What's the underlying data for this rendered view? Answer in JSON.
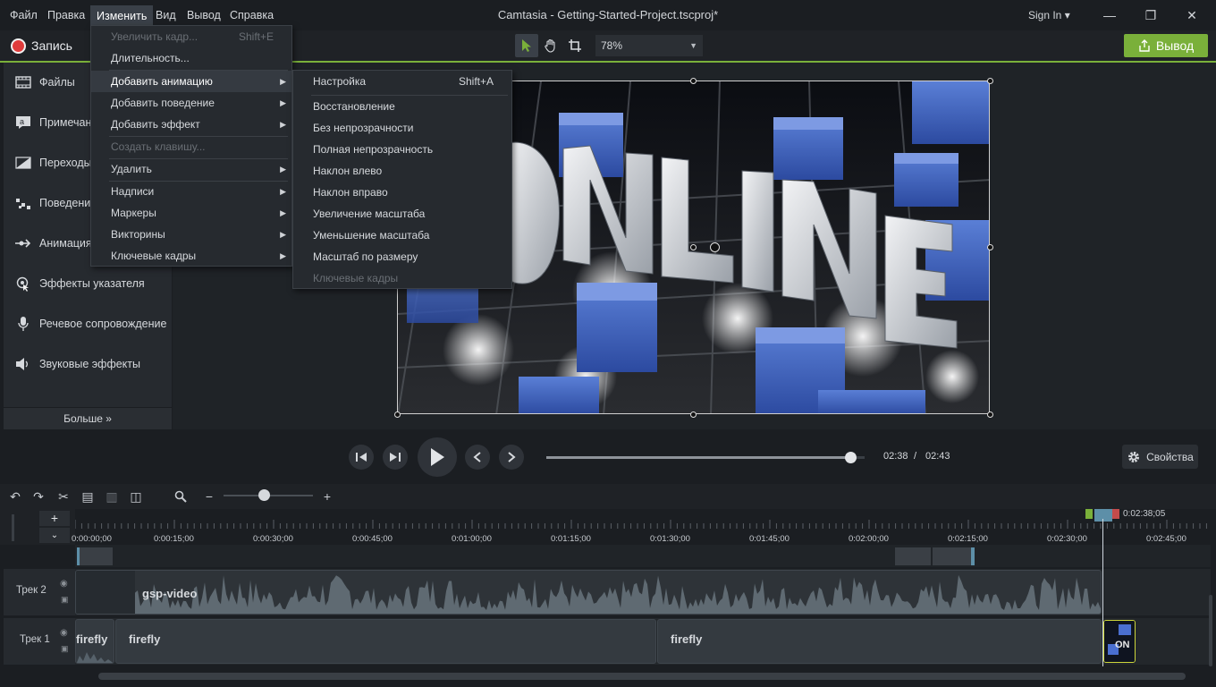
{
  "menubar": {
    "items": [
      "Файл",
      "Правка",
      "Изменить",
      "Вид",
      "Вывод",
      "Справка"
    ],
    "active": "Изменить"
  },
  "window": {
    "title": "Camtasia - Getting-Started-Project.tscproj*",
    "signin": "Sign In ▾",
    "minimize": "—",
    "maximize": "❐",
    "close": "✕"
  },
  "toolbar": {
    "record_label": "Запись",
    "zoom_value": "78%",
    "export_label": "Вывод"
  },
  "left_panel": {
    "items": [
      {
        "label": "Файлы",
        "icon": "film-icon"
      },
      {
        "label": "Примечания",
        "icon": "annotation-icon"
      },
      {
        "label": "Переходы",
        "icon": "transition-icon"
      },
      {
        "label": "Поведения",
        "icon": "behavior-icon"
      },
      {
        "label": "Анимация",
        "icon": "animation-icon"
      },
      {
        "label": "Эффекты указателя",
        "icon": "cursor-effects-icon"
      },
      {
        "label": "Речевое сопровождение",
        "icon": "microphone-icon"
      },
      {
        "label": "Звуковые эффекты",
        "icon": "speaker-icon"
      }
    ],
    "more_label": "Больше »"
  },
  "edit_menu": {
    "items": [
      {
        "label": "Увеличить кадр...",
        "shortcut": "Shift+E",
        "disabled": true
      },
      {
        "label": "Длительность...",
        "shortcut": "",
        "disabled": false
      },
      {
        "label": "Добавить анимацию",
        "submenu": true,
        "highlighted": true
      },
      {
        "label": "Добавить поведение",
        "submenu": true
      },
      {
        "label": "Добавить эффект",
        "submenu": true
      },
      {
        "label": "Создать клавишу...",
        "disabled": true
      },
      {
        "label": "Удалить",
        "submenu": true
      },
      {
        "label": "Надписи",
        "submenu": true
      },
      {
        "label": "Маркеры",
        "submenu": true
      },
      {
        "label": "Викторины",
        "submenu": true
      },
      {
        "label": "Ключевые кадры",
        "submenu": true
      }
    ]
  },
  "animation_submenu": {
    "items": [
      {
        "label": "Настройка",
        "shortcut": "Shift+A"
      },
      {
        "label": "Восстановление"
      },
      {
        "label": "Без непрозрачности"
      },
      {
        "label": "Полная непрозрачность"
      },
      {
        "label": "Наклон влево"
      },
      {
        "label": "Наклон вправо"
      },
      {
        "label": "Увеличение масштаба"
      },
      {
        "label": "Уменьшение масштаба"
      },
      {
        "label": "Масштаб по размеру"
      },
      {
        "label": "Ключевые кадры",
        "disabled": true
      }
    ]
  },
  "playback": {
    "current_time": "02:38",
    "separator": "/",
    "total_time": "02:43",
    "progress": 0.96,
    "properties_label": "Свойства"
  },
  "timeline": {
    "ruler_labels": [
      "0:00:00;00",
      "0:00:15;00",
      "0:00:30;00",
      "0:00:45;00",
      "0:01:00;00",
      "0:01:15;00",
      "0:01:30;00",
      "0:01:45;00",
      "0:02:00;00",
      "0:02:15;00",
      "0:02:30;00",
      "0:02:45;00"
    ],
    "playhead_time": "0:02:38;05",
    "tracks": [
      {
        "label": "Трек 2",
        "clips": [
          {
            "label": "gsp-video"
          }
        ]
      },
      {
        "label": "Трек 1",
        "clips": [
          {
            "label": "firefly"
          },
          {
            "label": "firefly"
          },
          {
            "label": "firefly"
          }
        ]
      }
    ]
  },
  "colors": {
    "accent": "#7ab03a",
    "record": "#e03c3c",
    "background": "#1b1e22"
  }
}
